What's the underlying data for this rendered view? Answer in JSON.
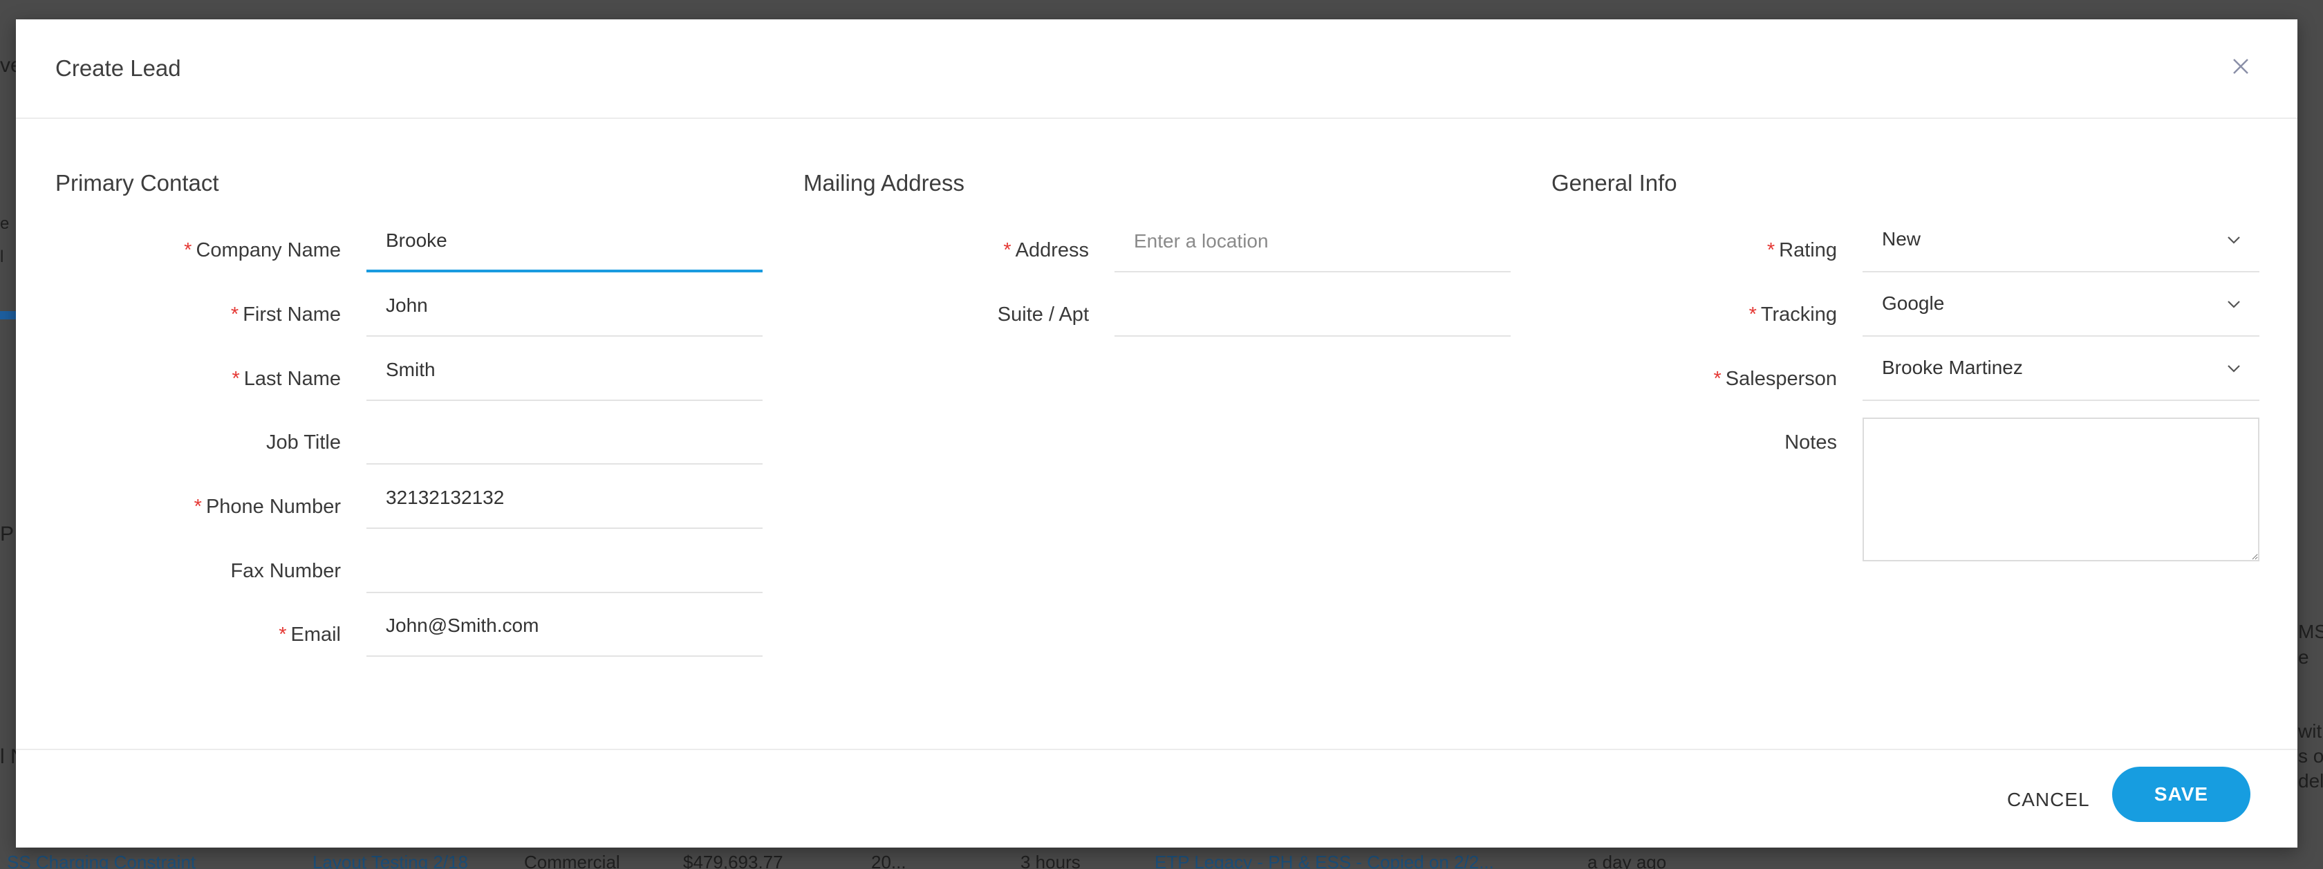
{
  "background": {
    "fragments": [
      "ve",
      "e",
      "l",
      "P",
      "l N",
      "MS",
      "e",
      "with",
      "s of",
      "del"
    ],
    "bottom_row": [
      "SS Charging Constraint",
      "Layout Testing 2/18",
      "Commercial",
      "$479,693.77",
      "20...",
      "3 hours",
      "ETP Legacy - PH & ESS - Copied on 2/2...",
      "a day ago"
    ]
  },
  "modal": {
    "title": "Create Lead",
    "close_icon": "close-icon"
  },
  "sections": {
    "primary_contact": "Primary Contact",
    "mailing_address": "Mailing Address",
    "general_info": "General Info"
  },
  "primary_contact": {
    "company_name": {
      "label": "Company Name",
      "required": true,
      "value": "Brooke"
    },
    "first_name": {
      "label": "First Name",
      "required": true,
      "value": "John"
    },
    "last_name": {
      "label": "Last Name",
      "required": true,
      "value": "Smith"
    },
    "job_title": {
      "label": "Job Title",
      "required": false,
      "value": ""
    },
    "phone_number": {
      "label": "Phone Number",
      "required": true,
      "value": "32132132132"
    },
    "fax_number": {
      "label": "Fax Number",
      "required": false,
      "value": ""
    },
    "email": {
      "label": "Email",
      "required": true,
      "value": "John@Smith.com"
    }
  },
  "mailing_address": {
    "address": {
      "label": "Address",
      "required": true,
      "value": "",
      "placeholder": "Enter a location"
    },
    "suite": {
      "label": "Suite / Apt",
      "required": false,
      "value": ""
    }
  },
  "general_info": {
    "rating": {
      "label": "Rating",
      "required": true,
      "value": "New"
    },
    "tracking": {
      "label": "Tracking",
      "required": true,
      "value": "Google"
    },
    "salesperson": {
      "label": "Salesperson",
      "required": true,
      "value": "Brooke Martinez"
    },
    "notes": {
      "label": "Notes",
      "required": false,
      "value": ""
    }
  },
  "footer": {
    "cancel_label": "CANCEL",
    "save_label": "SAVE"
  },
  "colors": {
    "accent": "#179de0",
    "required": "#e53935",
    "focus_underline": "#1a9be0"
  }
}
